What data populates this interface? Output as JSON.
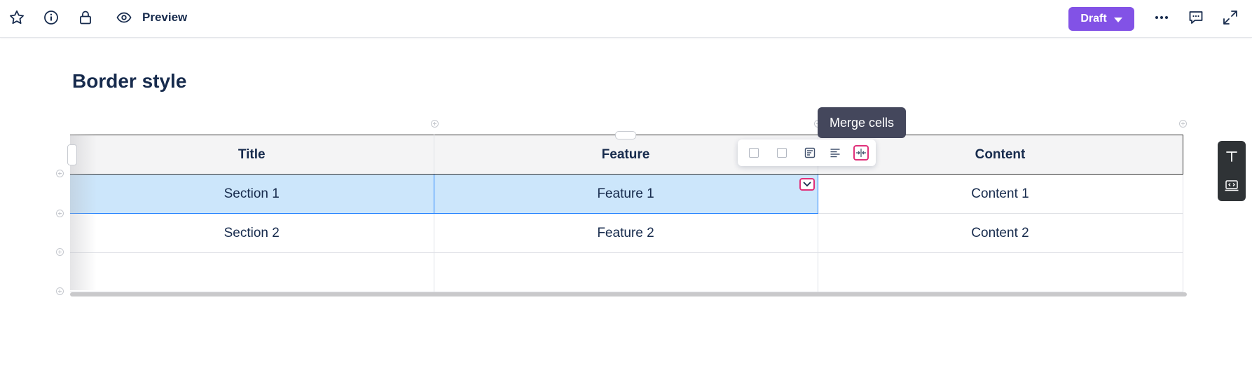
{
  "topbar": {
    "icons": [
      "star-icon",
      "info-icon",
      "lock-icon",
      "eye-icon",
      "more-icon",
      "comment-icon",
      "expand-icon"
    ],
    "preview_label": "Preview",
    "draft_label": "Draft"
  },
  "page": {
    "title": "Border style"
  },
  "table": {
    "headers": [
      "Title",
      "Feature",
      "Content"
    ],
    "rows": [
      [
        "Section 1",
        "Feature 1",
        "Content 1"
      ],
      [
        "Section 2",
        "Feature 2",
        "Content 2"
      ],
      [
        "",
        "",
        ""
      ]
    ],
    "selected_row": 0,
    "selected_columns": [
      0,
      1
    ]
  },
  "cell_toolbar": {
    "buttons": [
      "background-color-swatch",
      "border-color-swatch",
      "cell-options-icon",
      "align-left-icon",
      "merge-cells-icon"
    ],
    "tooltip": "Merge cells",
    "active_button": "merge-cells-icon"
  },
  "side_panel": {
    "buttons": [
      "text-icon",
      "embed-code-icon"
    ]
  },
  "colors": {
    "accent": "#8252e6",
    "selection": "#cce6fb",
    "highlight": "#e0307a",
    "tooltip_bg": "#44475c"
  }
}
